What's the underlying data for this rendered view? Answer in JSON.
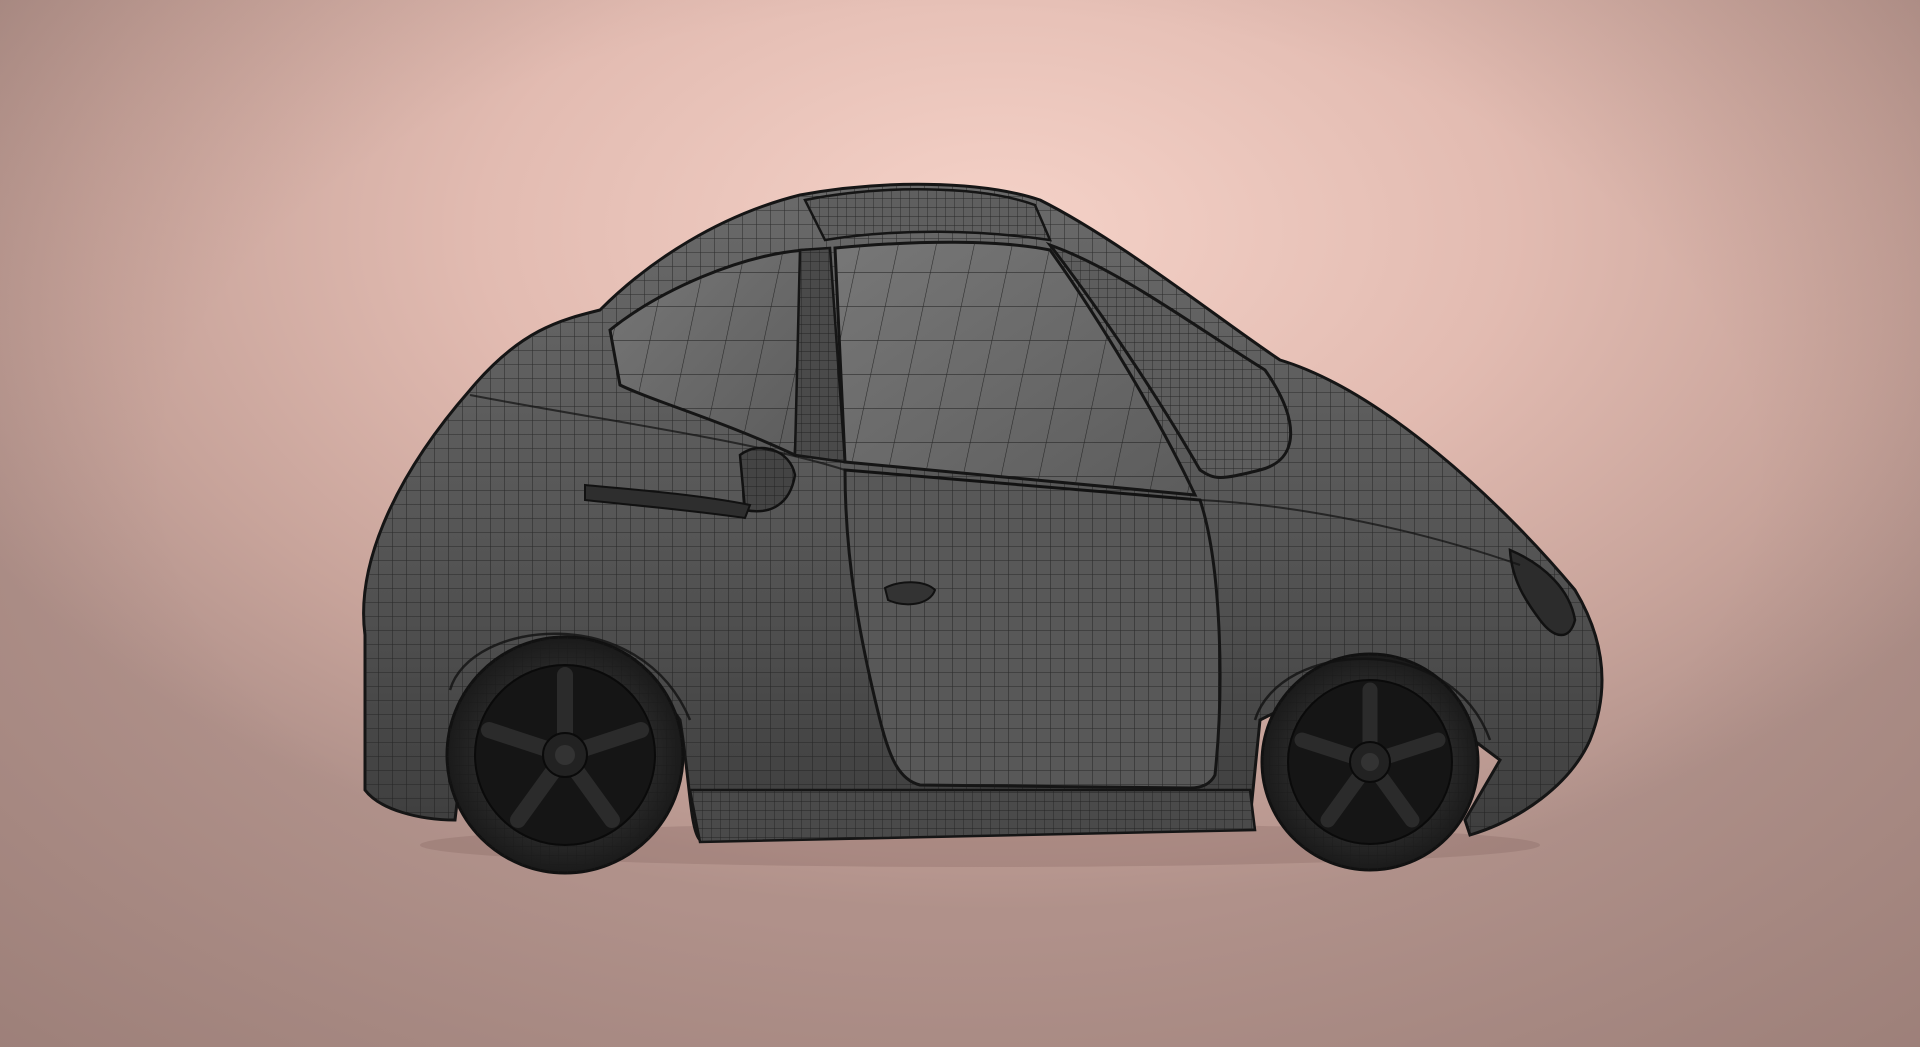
{
  "scene": {
    "subject": "car-wireframe",
    "colors": {
      "background_center": "#f5d2c8",
      "background_edge": "#b0918a",
      "body": "#5a5a5a",
      "body_dark": "#3c3c3c",
      "wire": "#1a1a1a",
      "tire": "#2a2a2a",
      "rim": "#111111"
    }
  }
}
